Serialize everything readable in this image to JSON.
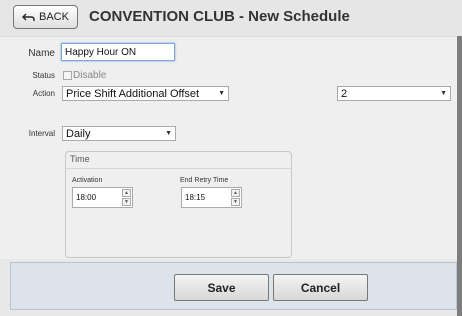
{
  "header": {
    "back_label": "BACK",
    "title": "CONVENTION CLUB - New Schedule"
  },
  "form": {
    "name_label": "Name",
    "name_value": "Happy Hour ON",
    "status_label": "Status",
    "status_option": "Disable",
    "status_checked": false,
    "action_label": "Action",
    "action_value": "Price Shift Additional Offset",
    "offset_value": "2",
    "interval_label": "Interval",
    "interval_value": "Daily"
  },
  "time": {
    "legend": "Time",
    "activation_label": "Activation",
    "activation_value": "18:00",
    "end_retry_label": "End Retry Time",
    "end_retry_value": "18:15"
  },
  "footer": {
    "save_label": "Save",
    "cancel_label": "Cancel"
  },
  "icons": {
    "back": "back-arrow-icon",
    "dropdown": "chevron-down-icon",
    "spin_up": "chevron-up-icon",
    "spin_down": "chevron-down-icon"
  },
  "colors": {
    "focus_border": "#7aa7d9",
    "footer_bg": "#dde3ea"
  }
}
